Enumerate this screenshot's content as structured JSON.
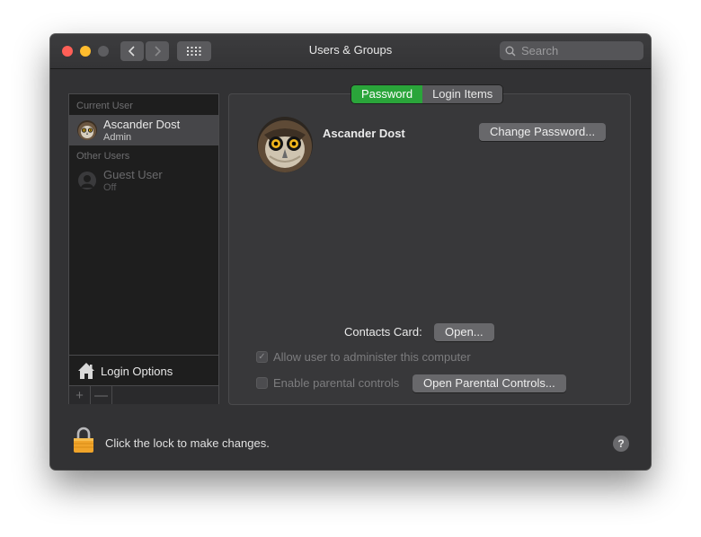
{
  "window": {
    "title": "Users & Groups"
  },
  "toolbar": {
    "back_icon": "chevron-left-icon",
    "forward_icon": "chevron-right-icon",
    "grid_icon": "grid-icon",
    "search_placeholder": "Search"
  },
  "sidebar": {
    "current_user_label": "Current User",
    "current_user": {
      "name": "Ascander Dost",
      "role": "Admin"
    },
    "other_users_label": "Other Users",
    "other_users": [
      {
        "name": "Guest User",
        "role": "Off"
      }
    ],
    "login_options_label": "Login Options",
    "add_symbol": "+",
    "remove_symbol": "—"
  },
  "tabs": [
    {
      "label": "Password",
      "active": true
    },
    {
      "label": "Login Items",
      "active": false
    }
  ],
  "account": {
    "name": "Ascander Dost",
    "change_password_label": "Change Password..."
  },
  "contacts": {
    "label": "Contacts Card:",
    "open_label": "Open..."
  },
  "checkboxes": {
    "admin_label": "Allow user to administer this computer",
    "admin_checked": true,
    "parental_label": "Enable parental controls",
    "parental_checked": false
  },
  "parental_button_label": "Open Parental Controls...",
  "footer": {
    "lock_text": "Click the lock to make changes.",
    "help_symbol": "?"
  },
  "colors": {
    "accent_green": "#2aa53a",
    "close": "#ff5f57",
    "minimize": "#febc2e"
  }
}
